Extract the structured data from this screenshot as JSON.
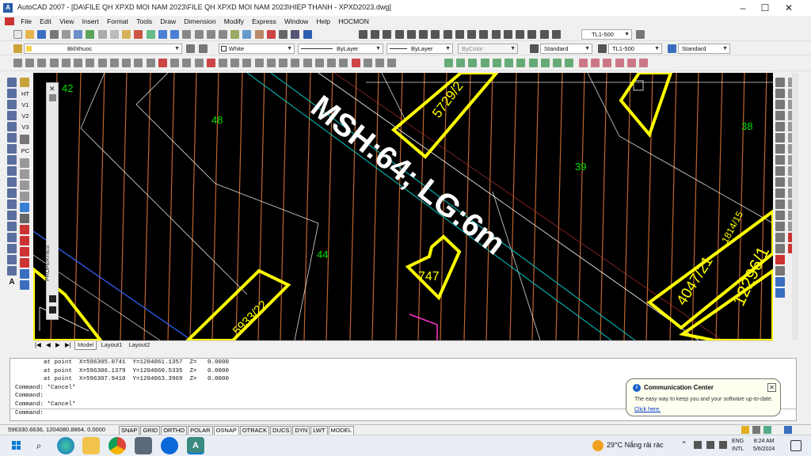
{
  "window": {
    "app_title": "AutoCAD 2007 - [DA\\FILE QH XPXD MOI NAM 2023\\FILE QH XPXD MOI NAM 2023\\HIEP THANH - XPXD2023.dwg]",
    "minimize": "–",
    "maximize": "☐",
    "close": "✕"
  },
  "menu": [
    "File",
    "Edit",
    "View",
    "Insert",
    "Format",
    "Tools",
    "Draw",
    "Dimension",
    "Modify",
    "Express",
    "Window",
    "Help",
    "HOCMON"
  ],
  "toolbar": {
    "textstyle_select": "TL1-500",
    "layer_select": "Bkhthuoc",
    "color_select": "White",
    "linetype_select": "ByLayer",
    "lineweight_select": "ByLayer",
    "plotstyle_select": "ByColor",
    "style_select": "Standard",
    "dimstyle_select": "TL1-500",
    "tablestyle_select": "Standard"
  },
  "left_toolbar": {
    "text_buttons": [
      "HT",
      "V1",
      "V2",
      "V3",
      "PC"
    ]
  },
  "properties_palette": {
    "label": "PROPERTIES"
  },
  "drawing": {
    "road_label": "MSH:64; LG:6m",
    "parcel_numbers": [
      "42",
      "48",
      "39",
      "38",
      "44"
    ],
    "lot_labels": [
      "5729/2",
      "747",
      "5933/22",
      "4047/21",
      "1814/15",
      "12296/1"
    ],
    "colors": {
      "background": "#000000",
      "parcel_number": "#00e000",
      "lot_border": "#ffff00",
      "road_label": "#ffffff",
      "grid_line": "#c86a32",
      "boundary": "#ffffff",
      "cyan_line": "#00c8c8",
      "magenta_line": "#ff33cc",
      "blue_line": "#3366ff"
    }
  },
  "tabs": [
    "Model",
    "Layout1",
    "Layout2"
  ],
  "command_lines": [
    "        at point  X=596305.0741  Y=1204061.1357  Z=   0.0000",
    "        at point  X=596306.1379  Y=1204060.5335  Z=   0.0000",
    "        at point  X=596307.9410  Y=1204063.3969  Z=   0.0000",
    "Command: *Cancel*",
    "Command:",
    "Command: *Cancel*",
    "",
    "Command:"
  ],
  "status_bar": {
    "coordinates": "596330.6636, 1204080.8864, 0.0000",
    "buttons": [
      {
        "label": "SNAP",
        "on": false
      },
      {
        "label": "GRID",
        "on": false
      },
      {
        "label": "ORTHO",
        "on": false
      },
      {
        "label": "POLAR",
        "on": false
      },
      {
        "label": "OSNAP",
        "on": true
      },
      {
        "label": "OTRACK",
        "on": false
      },
      {
        "label": "DUCS",
        "on": false
      },
      {
        "label": "DYN",
        "on": false
      },
      {
        "label": "LWT",
        "on": false
      },
      {
        "label": "MODEL",
        "on": true
      }
    ]
  },
  "notification": {
    "title": "Communication Center",
    "message": "The easy way to keep you and your software up-to-date.",
    "link": "Click here.",
    "close": "✕"
  },
  "taskbar": {
    "weather": "29°C  Nắng rải rác",
    "language_line1": "ENG",
    "language_line2": "INTL",
    "time": "8:24 AM",
    "date": "5/6/2024",
    "icons": [
      "start-icon",
      "search-icon",
      "edge-icon",
      "file-explorer-icon",
      "chrome-icon",
      "calculator-icon",
      "zalo-icon",
      "autocad-icon"
    ]
  }
}
